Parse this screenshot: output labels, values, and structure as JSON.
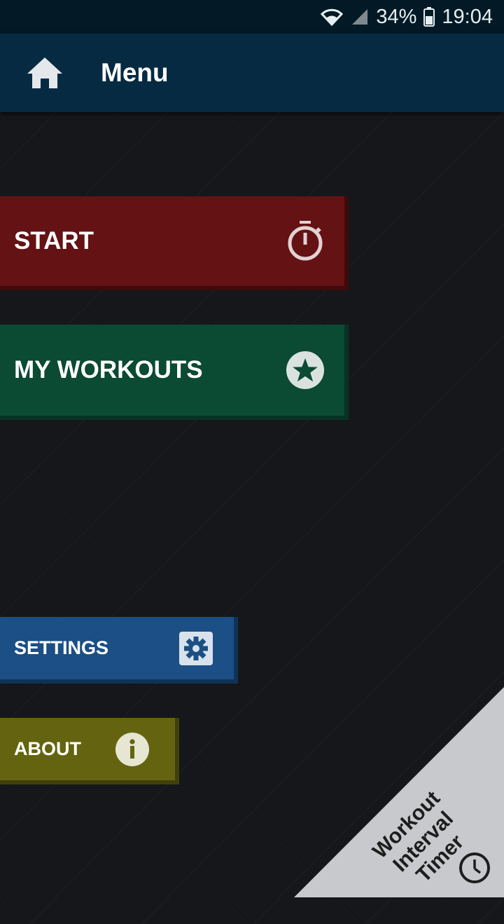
{
  "status_bar": {
    "battery_percent": "34%",
    "time": "19:04",
    "icons": [
      "wifi-icon",
      "signal-icon",
      "battery-icon"
    ]
  },
  "app_bar": {
    "title": "Menu",
    "home_icon": "home-icon"
  },
  "menu": {
    "start": {
      "label": "START",
      "icon": "stopwatch-icon",
      "color": "#641214"
    },
    "my_workouts": {
      "label": "MY WORKOUTS",
      "icon": "star-icon",
      "color": "#0b4a33"
    },
    "settings": {
      "label": "SETTINGS",
      "icon": "gear-icon",
      "color": "#1b4f85"
    },
    "about": {
      "label": "ABOUT",
      "icon": "info-icon",
      "color": "#646410"
    }
  },
  "branding": {
    "app_name_line1": "Workout Interval",
    "app_name_line2": "Timer",
    "icon": "clock-icon"
  }
}
